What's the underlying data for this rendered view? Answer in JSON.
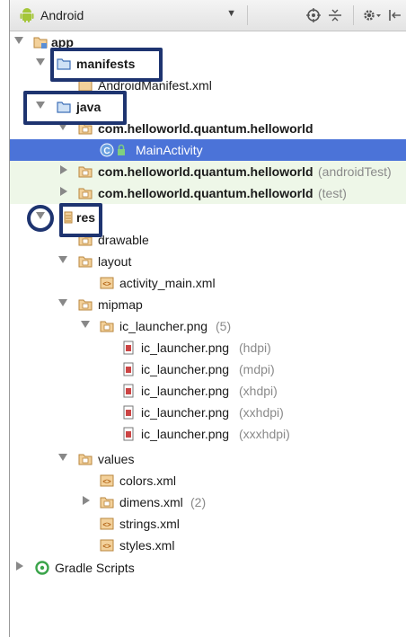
{
  "toolbar": {
    "view_mode": "Android"
  },
  "tree": {
    "app": "app",
    "manifests": "manifests",
    "manifest_file": "AndroidManifest.xml",
    "java": "java",
    "pkg_main": "com.helloworld.quantum.helloworld",
    "main_activity": "MainActivity",
    "pkg_android_test": "com.helloworld.quantum.helloworld",
    "pkg_android_test_hint": "(androidTest)",
    "pkg_test": "com.helloworld.quantum.helloworld",
    "pkg_test_hint": "(test)",
    "res": "res",
    "drawable": "drawable",
    "layout": "layout",
    "activity_main": "activity_main.xml",
    "mipmap": "mipmap",
    "ic_launcher_group": "ic_launcher.png",
    "ic_launcher_group_hint": "(5)",
    "ic_launcher": "ic_launcher.png",
    "hdpi": "(hdpi)",
    "mdpi": "(mdpi)",
    "xhdpi": "(xhdpi)",
    "xxhdpi": "(xxhdpi)",
    "xxxhdpi": "(xxxhdpi)",
    "values": "values",
    "colors": "colors.xml",
    "dimens": "dimens.xml",
    "dimens_hint": "(2)",
    "strings": "strings.xml",
    "styles": "styles.xml",
    "gradle": "Gradle Scripts"
  },
  "colors": {
    "selection": "#4b73d8",
    "highlight_box": "#1e3470",
    "test_tint": "#eef7e8",
    "android_green": "#a4c639"
  }
}
